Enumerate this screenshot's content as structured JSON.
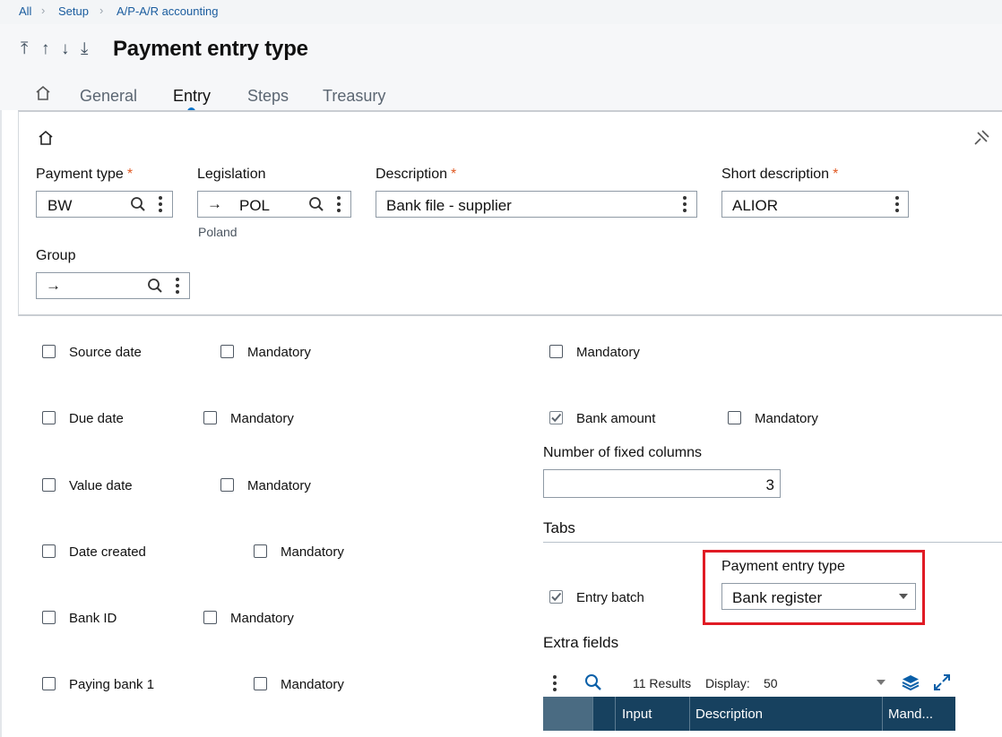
{
  "breadcrumb": [
    "All",
    "Setup",
    "A/P-A/R accounting"
  ],
  "page": {
    "title": "Payment entry type"
  },
  "tabs": [
    "General",
    "Entry",
    "Steps",
    "Treasury"
  ],
  "form": {
    "payment_type": {
      "label": "Payment type",
      "value": "BW",
      "required": "*"
    },
    "legislation": {
      "label": "Legislation",
      "value": "POL",
      "subtext": "Poland"
    },
    "description": {
      "label": "Description",
      "value": "Bank file - supplier",
      "required": "*"
    },
    "short_description": {
      "label": "Short description",
      "value": "ALIOR",
      "required": "*"
    },
    "group": {
      "label": "Group",
      "value": ""
    }
  },
  "left_checks": [
    {
      "label": "Source date",
      "checked": false,
      "mandatory_label": "Mandatory",
      "mandatory_checked": false
    },
    {
      "label": "Due date",
      "checked": false,
      "mandatory_label": "Mandatory",
      "mandatory_checked": false
    },
    {
      "label": "Value date",
      "checked": false,
      "mandatory_label": "Mandatory",
      "mandatory_checked": false
    },
    {
      "label": "Date created",
      "checked": false,
      "mandatory_label": "Mandatory",
      "mandatory_checked": false
    },
    {
      "label": "Bank ID",
      "checked": false,
      "mandatory_label": "Mandatory",
      "mandatory_checked": false
    },
    {
      "label": "Paying bank 1",
      "checked": false,
      "mandatory_label": "Mandatory",
      "mandatory_checked": false
    }
  ],
  "right": {
    "mandatory_top": {
      "label": "Mandatory",
      "checked": false
    },
    "bank_amount": {
      "label": "Bank amount",
      "checked": true,
      "mandatory_label": "Mandatory",
      "mandatory_checked": false
    },
    "fixed_columns": {
      "label": "Number of fixed columns",
      "value": "3"
    },
    "tabs_section": "Tabs",
    "entry_batch": {
      "label": "Entry batch",
      "checked": true
    },
    "payment_entry_type": {
      "label": "Payment entry type",
      "value": "Bank register"
    },
    "extra_fields": {
      "title": "Extra fields",
      "results": "11 Results",
      "display_label": "Display:",
      "display_value": "50",
      "columns": [
        "Input",
        "Description",
        "Mand..."
      ]
    }
  }
}
